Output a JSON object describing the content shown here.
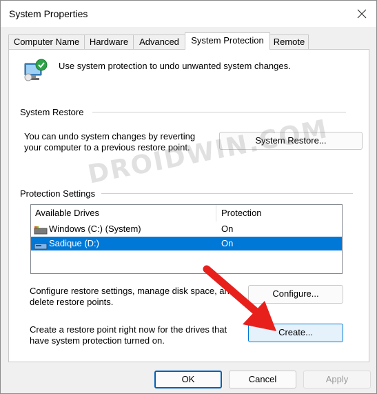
{
  "window": {
    "title": "System Properties"
  },
  "tabs": [
    {
      "label": "Computer Name",
      "active": false
    },
    {
      "label": "Hardware",
      "active": false
    },
    {
      "label": "Advanced",
      "active": false
    },
    {
      "label": "System Protection",
      "active": true
    },
    {
      "label": "Remote",
      "active": false
    }
  ],
  "intro": {
    "text": "Use system protection to undo unwanted system changes."
  },
  "system_restore": {
    "heading": "System Restore",
    "line1": "You can undo system changes by reverting",
    "line2": "your computer to a previous restore point.",
    "button": "System Restore..."
  },
  "protection": {
    "heading": "Protection Settings",
    "columns": [
      "Available Drives",
      "Protection"
    ],
    "rows": [
      {
        "drive": "Windows (C:) (System)",
        "protection": "On",
        "selected": false
      },
      {
        "drive": "Sadique (D:)",
        "protection": "On",
        "selected": true
      }
    ],
    "configure_line1": "Configure restore settings, manage disk space, and",
    "configure_line2": "delete restore points.",
    "configure_button": "Configure...",
    "create_line1": "Create a restore point right now for the drives that",
    "create_line2": "have system protection turned on.",
    "create_button": "Create..."
  },
  "footer": {
    "ok": "OK",
    "cancel": "Cancel",
    "apply": "Apply"
  },
  "watermark": "DROIDWIN.COM",
  "colors": {
    "selection": "#0078d7",
    "arrow": "#e8201c",
    "accent": "#005fb8"
  }
}
